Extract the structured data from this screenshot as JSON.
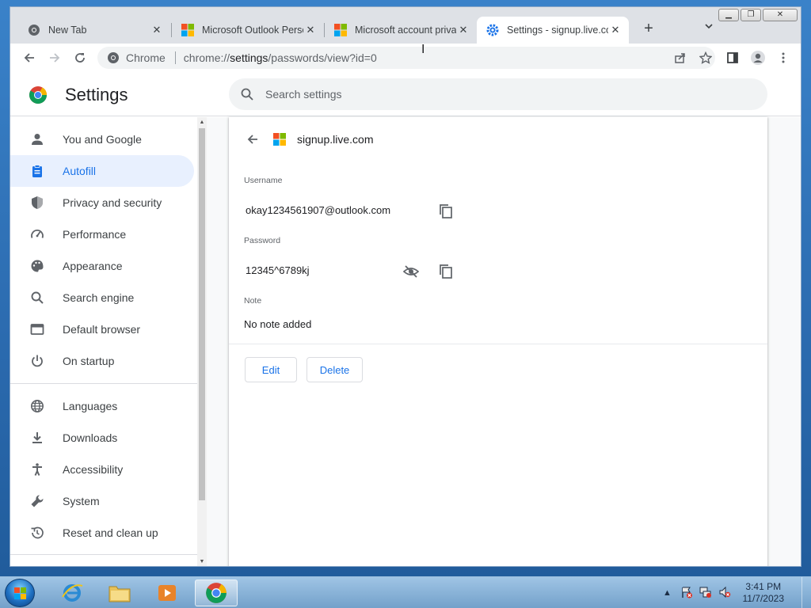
{
  "browser": {
    "tabs": [
      {
        "title": "New Tab",
        "icon": "chrome-icon"
      },
      {
        "title": "Microsoft Outlook Person",
        "icon": "microsoft-logo-icon"
      },
      {
        "title": "Microsoft account privac",
        "icon": "microsoft-logo-icon"
      },
      {
        "title": "Settings - signup.live.co",
        "icon": "gear-icon",
        "active": true
      }
    ],
    "omnibox": {
      "chip": "Chrome",
      "url_scheme": "chrome://",
      "url_host": "settings",
      "url_path": "/passwords/view?id=0"
    }
  },
  "settings": {
    "title": "Settings",
    "search_placeholder": "Search settings",
    "nav": [
      {
        "label": "You and Google",
        "icon": "person-icon"
      },
      {
        "label": "Autofill",
        "icon": "clipboard-icon",
        "active": true
      },
      {
        "label": "Privacy and security",
        "icon": "shield-icon"
      },
      {
        "label": "Performance",
        "icon": "speedometer-icon"
      },
      {
        "label": "Appearance",
        "icon": "palette-icon"
      },
      {
        "label": "Search engine",
        "icon": "search-icon"
      },
      {
        "label": "Default browser",
        "icon": "browser-window-icon"
      },
      {
        "label": "On startup",
        "icon": "power-icon"
      },
      {
        "label": "Languages",
        "icon": "globe-icon"
      },
      {
        "label": "Downloads",
        "icon": "download-icon"
      },
      {
        "label": "Accessibility",
        "icon": "accessibility-icon"
      },
      {
        "label": "System",
        "icon": "wrench-icon"
      },
      {
        "label": "Reset and clean up",
        "icon": "history-icon"
      }
    ],
    "password_detail": {
      "site": "signup.live.com",
      "username_label": "Username",
      "username": "okay1234561907@outlook.com",
      "password_label": "Password",
      "password": "12345^6789kj",
      "note_label": "Note",
      "note": "No note added",
      "edit_label": "Edit",
      "delete_label": "Delete"
    }
  },
  "taskbar": {
    "time": "3:41 PM",
    "date": "11/7/2023"
  },
  "colors": {
    "accent": "#1a73e8",
    "active_nav_bg": "#e8f0fe"
  }
}
